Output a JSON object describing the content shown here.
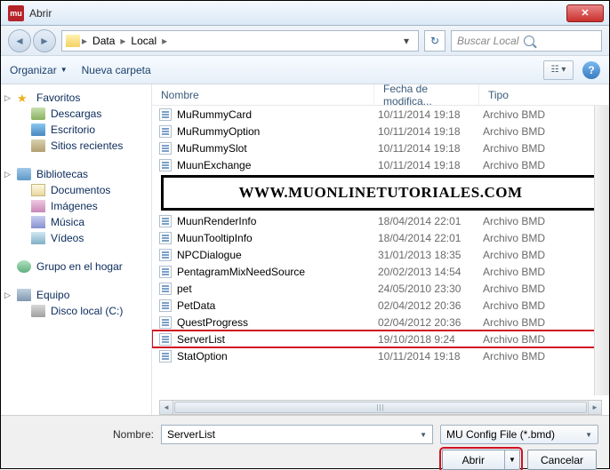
{
  "title": "Abrir",
  "app_icon_text": "mu",
  "breadcrumb": {
    "items": [
      "Data",
      "Local"
    ]
  },
  "search": {
    "placeholder": "Buscar Local"
  },
  "toolbar": {
    "organize": "Organizar",
    "newfolder": "Nueva carpeta"
  },
  "sidebar": {
    "favorites": {
      "head": "Favoritos",
      "items": [
        "Descargas",
        "Escritorio",
        "Sitios recientes"
      ]
    },
    "libraries": {
      "head": "Bibliotecas",
      "items": [
        "Documentos",
        "Imágenes",
        "Música",
        "Vídeos"
      ]
    },
    "homegroup": {
      "head": "Grupo en el hogar"
    },
    "computer": {
      "head": "Equipo",
      "items": [
        "Disco local (C:)"
      ]
    }
  },
  "columns": {
    "name": "Nombre",
    "date": "Fecha de modifica...",
    "type": "Tipo"
  },
  "watermark": "WWW.MUONLINETUTORIALES.COM",
  "files": [
    {
      "name": "MuRummyCard",
      "date": "10/11/2014 19:18",
      "type": "Archivo BMD"
    },
    {
      "name": "MuRummyOption",
      "date": "10/11/2014 19:18",
      "type": "Archivo BMD"
    },
    {
      "name": "MuRummySlot",
      "date": "10/11/2014 19:18",
      "type": "Archivo BMD"
    },
    {
      "name": "MuunExchange",
      "date": "10/11/2014 19:18",
      "type": "Archivo BMD"
    },
    {
      "name": "MuunRenderInfo",
      "date": "18/04/2014 22:01",
      "type": "Archivo BMD"
    },
    {
      "name": "MuunTooltipInfo",
      "date": "18/04/2014 22:01",
      "type": "Archivo BMD"
    },
    {
      "name": "NPCDialogue",
      "date": "31/01/2013 18:35",
      "type": "Archivo BMD"
    },
    {
      "name": "PentagramMixNeedSource",
      "date": "20/02/2013 14:54",
      "type": "Archivo BMD"
    },
    {
      "name": "pet",
      "date": "24/05/2010 23:30",
      "type": "Archivo BMD"
    },
    {
      "name": "PetData",
      "date": "02/04/2012 20:36",
      "type": "Archivo BMD"
    },
    {
      "name": "QuestProgress",
      "date": "02/04/2012 20:36",
      "type": "Archivo BMD"
    },
    {
      "name": "ServerList",
      "date": "19/10/2018 9:24",
      "type": "Archivo BMD",
      "hl": true
    },
    {
      "name": "StatOption",
      "date": "10/11/2014 19:18",
      "type": "Archivo BMD"
    }
  ],
  "bottom": {
    "name_label": "Nombre:",
    "name_value": "ServerList",
    "type_value": "MU Config File (*.bmd)",
    "open": "Abrir",
    "cancel": "Cancelar"
  }
}
